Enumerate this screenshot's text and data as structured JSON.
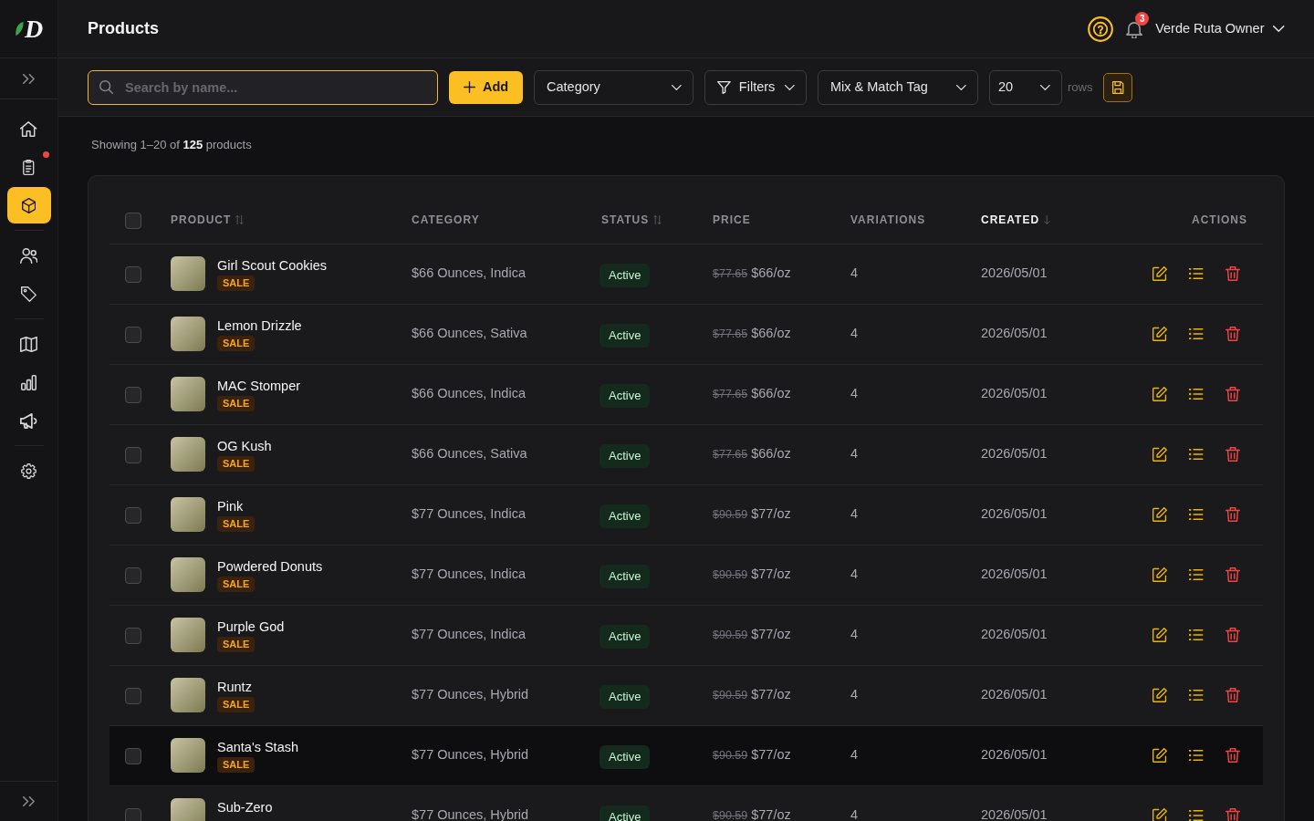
{
  "sidebar": {
    "logo": "D",
    "groups": [
      {
        "items": [
          {
            "selected": false,
            "alert": false
          },
          {
            "selected": false,
            "alert": true
          },
          {
            "selected": true,
            "alert": false
          }
        ]
      },
      {
        "items": [
          {
            "selected": false,
            "alert": false
          },
          {
            "selected": false,
            "alert": false
          }
        ]
      },
      {
        "items": [
          {
            "selected": false,
            "alert": false
          },
          {
            "selected": false,
            "alert": false
          },
          {
            "selected": false,
            "alert": false
          }
        ]
      },
      {
        "items": [
          {
            "selected": false,
            "alert": false
          }
        ]
      }
    ]
  },
  "header": {
    "title": "Products",
    "notification_count": "3",
    "user": "Verde Ruta Owner"
  },
  "toolbar": {
    "search": {
      "placeholder": "Search by name..."
    },
    "add_button": "Add",
    "category_select": "Category",
    "filters_button": "Filters",
    "tag_select": "Mix & Match Tag",
    "rows_select": "20",
    "rows_label": "rows"
  },
  "summary": "Showing 1–20 of **125** products",
  "table": {
    "select_all": {
      "checked": false
    },
    "columns": [
      {
        "label": "PRODUCT",
        "sortable": true,
        "selected": false
      },
      {
        "label": "CATEGORY",
        "sortable": false,
        "selected": false
      },
      {
        "label": "STATUS",
        "sortable": true,
        "selected": false
      },
      {
        "label": "PRICE",
        "sortable": false,
        "selected": false
      },
      {
        "label": "VARIATIONS",
        "sortable": false,
        "selected": false
      },
      {
        "label": "CREATED",
        "sortable": true,
        "selected": true
      },
      {
        "label": "ACTIONS",
        "sortable": false,
        "selected": false
      }
    ],
    "rows": [
      {
        "name": "Girl Scout Cookies",
        "badge": "SALE",
        "category": "$66 Ounces, Indica",
        "status": "Active",
        "original_price": "$77.65",
        "price": "$66/oz",
        "variations": "4",
        "created": "2026/05/01",
        "checked": false,
        "hovered": false
      },
      {
        "name": "Lemon Drizzle",
        "badge": "SALE",
        "category": "$66 Ounces, Sativa",
        "status": "Active",
        "original_price": "$77.65",
        "price": "$66/oz",
        "variations": "4",
        "created": "2026/05/01",
        "checked": false,
        "hovered": false
      },
      {
        "name": "MAC Stomper",
        "badge": "SALE",
        "category": "$66 Ounces, Indica",
        "status": "Active",
        "original_price": "$77.65",
        "price": "$66/oz",
        "variations": "4",
        "created": "2026/05/01",
        "checked": false,
        "hovered": false
      },
      {
        "name": "OG Kush",
        "badge": "SALE",
        "category": "$66 Ounces, Sativa",
        "status": "Active",
        "original_price": "$77.65",
        "price": "$66/oz",
        "variations": "4",
        "created": "2026/05/01",
        "checked": false,
        "hovered": false
      },
      {
        "name": "Pink",
        "badge": "SALE",
        "category": "$77 Ounces, Indica",
        "status": "Active",
        "original_price": "$90.59",
        "price": "$77/oz",
        "variations": "4",
        "created": "2026/05/01",
        "checked": false,
        "hovered": false
      },
      {
        "name": "Powdered Donuts",
        "badge": "SALE",
        "category": "$77 Ounces, Indica",
        "status": "Active",
        "original_price": "$90.59",
        "price": "$77/oz",
        "variations": "4",
        "created": "2026/05/01",
        "checked": false,
        "hovered": false
      },
      {
        "name": "Purple God",
        "badge": "SALE",
        "category": "$77 Ounces, Indica",
        "status": "Active",
        "original_price": "$90.59",
        "price": "$77/oz",
        "variations": "4",
        "created": "2026/05/01",
        "checked": false,
        "hovered": false
      },
      {
        "name": "Runtz",
        "badge": "SALE",
        "category": "$77 Ounces, Hybrid",
        "status": "Active",
        "original_price": "$90.59",
        "price": "$77/oz",
        "variations": "4",
        "created": "2026/05/01",
        "checked": false,
        "hovered": false
      },
      {
        "name": "Santa's Stash",
        "badge": "SALE",
        "category": "$77 Ounces, Hybrid",
        "status": "Active",
        "original_price": "$90.59",
        "price": "$77/oz",
        "variations": "4",
        "created": "2026/05/01",
        "checked": false,
        "hovered": true
      },
      {
        "name": "Sub-Zero",
        "category": "$77 Ounces, Hybrid",
        "status": "Active",
        "original_price": "$90.59",
        "price": "$77/oz",
        "variations": "4",
        "created": "2026/05/01",
        "checked": false,
        "hovered": false
      }
    ]
  }
}
